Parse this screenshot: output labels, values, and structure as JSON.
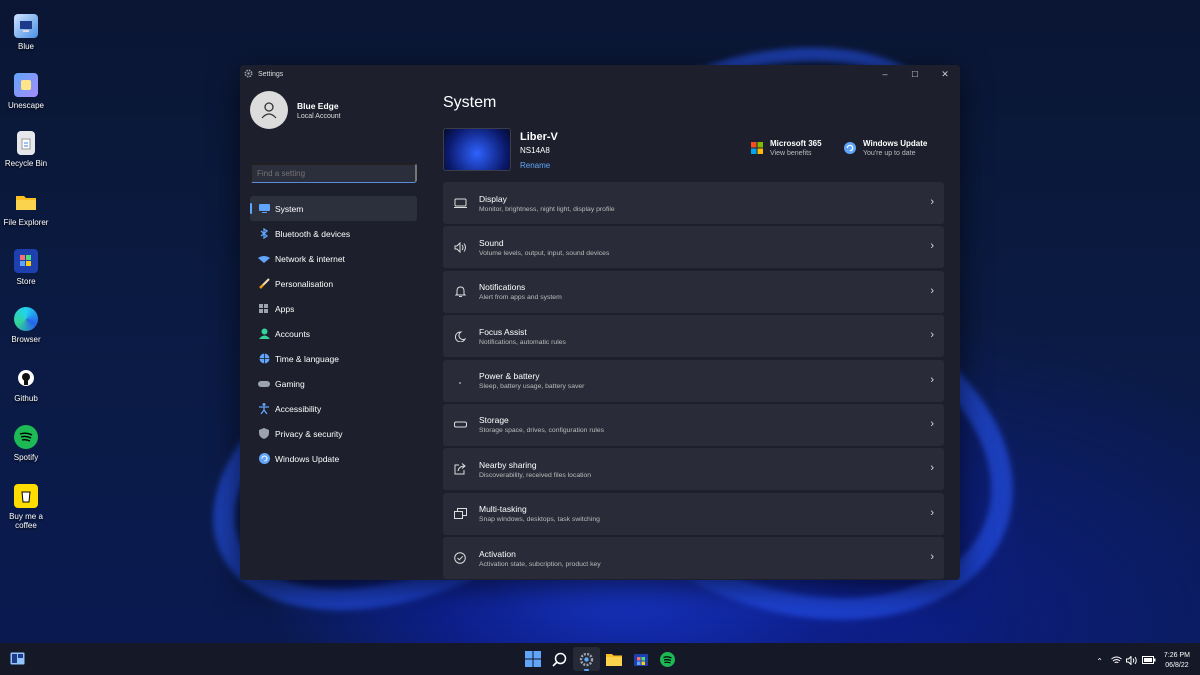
{
  "desktop": {
    "icons": [
      {
        "label": "Blue",
        "icon": "computer-icon"
      },
      {
        "label": "Unescape",
        "icon": "unescape-icon"
      },
      {
        "label": "Recycle Bin",
        "icon": "recycle-bin-icon"
      },
      {
        "label": "File Explorer",
        "icon": "folder-icon"
      },
      {
        "label": "Store",
        "icon": "store-icon"
      },
      {
        "label": "Browser",
        "icon": "edge-icon"
      },
      {
        "label": "Github",
        "icon": "github-icon"
      },
      {
        "label": "Spotify",
        "icon": "spotify-icon"
      },
      {
        "label": "Buy me a coffee",
        "icon": "coffee-icon"
      }
    ]
  },
  "window": {
    "title": "Settings",
    "controls": {
      "minimize": "–",
      "maximize": "☐",
      "close": "✕"
    }
  },
  "profile": {
    "name": "Blue Edge",
    "type": "Local Account"
  },
  "search": {
    "placeholder": "Find a setting"
  },
  "nav": [
    {
      "label": "System",
      "icon": "monitor-icon",
      "color": "#60a5fa",
      "active": true
    },
    {
      "label": "Bluetooth & devices",
      "icon": "bluetooth-icon",
      "color": "#60a5fa"
    },
    {
      "label": "Network & internet",
      "icon": "wifi-icon",
      "color": "#60a5fa"
    },
    {
      "label": "Personalisation",
      "icon": "brush-icon",
      "color": "#f59e0b"
    },
    {
      "label": "Apps",
      "icon": "apps-icon",
      "color": "#9ca3af"
    },
    {
      "label": "Accounts",
      "icon": "accounts-icon",
      "color": "#34d399"
    },
    {
      "label": "Time & language",
      "icon": "globe-icon",
      "color": "#60a5fa"
    },
    {
      "label": "Gaming",
      "icon": "gamepad-icon",
      "color": "#9ca3af"
    },
    {
      "label": "Accessibility",
      "icon": "accessibility-icon",
      "color": "#60a5fa"
    },
    {
      "label": "Privacy & security",
      "icon": "shield-icon",
      "color": "#9ca3af"
    },
    {
      "label": "Windows Update",
      "icon": "update-icon",
      "color": "#60a5fa"
    }
  ],
  "main": {
    "title": "System",
    "device": {
      "name": "Liber-V",
      "model": "NS14A8",
      "rename": "Rename"
    },
    "promos": [
      {
        "title": "Microsoft 365",
        "subtitle": "View benefits",
        "icon": "microsoft-icon"
      },
      {
        "title": "Windows Update",
        "subtitle": "You're up to date",
        "icon": "update-icon"
      }
    ],
    "rows": [
      {
        "title": "Display",
        "subtitle": "Monitor, brightness, night light, display profile",
        "icon": "display-icon"
      },
      {
        "title": "Sound",
        "subtitle": "Volume levels, output, input, sound devices",
        "icon": "speaker-icon"
      },
      {
        "title": "Notifications",
        "subtitle": "Alert from apps and system",
        "icon": "bell-icon"
      },
      {
        "title": "Focus Assist",
        "subtitle": "Notifications, automatic rules",
        "icon": "moon-icon"
      },
      {
        "title": "Power & battery",
        "subtitle": "Sleep, battery usage, battery saver",
        "icon": "power-icon"
      },
      {
        "title": "Storage",
        "subtitle": "Storage space, drives, configuration rules",
        "icon": "storage-icon"
      },
      {
        "title": "Nearby sharing",
        "subtitle": "Discoverability, received files location",
        "icon": "share-icon"
      },
      {
        "title": "Multi-tasking",
        "subtitle": "Snap windows, desktops, task switching",
        "icon": "multitask-icon"
      },
      {
        "title": "Activation",
        "subtitle": "Activation state, subcription, product key",
        "icon": "check-circle-icon"
      }
    ]
  },
  "taskbar": {
    "apps": [
      "start-icon",
      "search-icon",
      "settings-icon",
      "file-explorer-icon",
      "store-icon",
      "spotify-icon"
    ],
    "active_app": "settings-icon",
    "time": "7:26 PM",
    "date": "06/8/22"
  },
  "colors": {
    "accent": "#60a5fa",
    "window_bg": "#1d202c",
    "row_bg": "#292c38"
  }
}
